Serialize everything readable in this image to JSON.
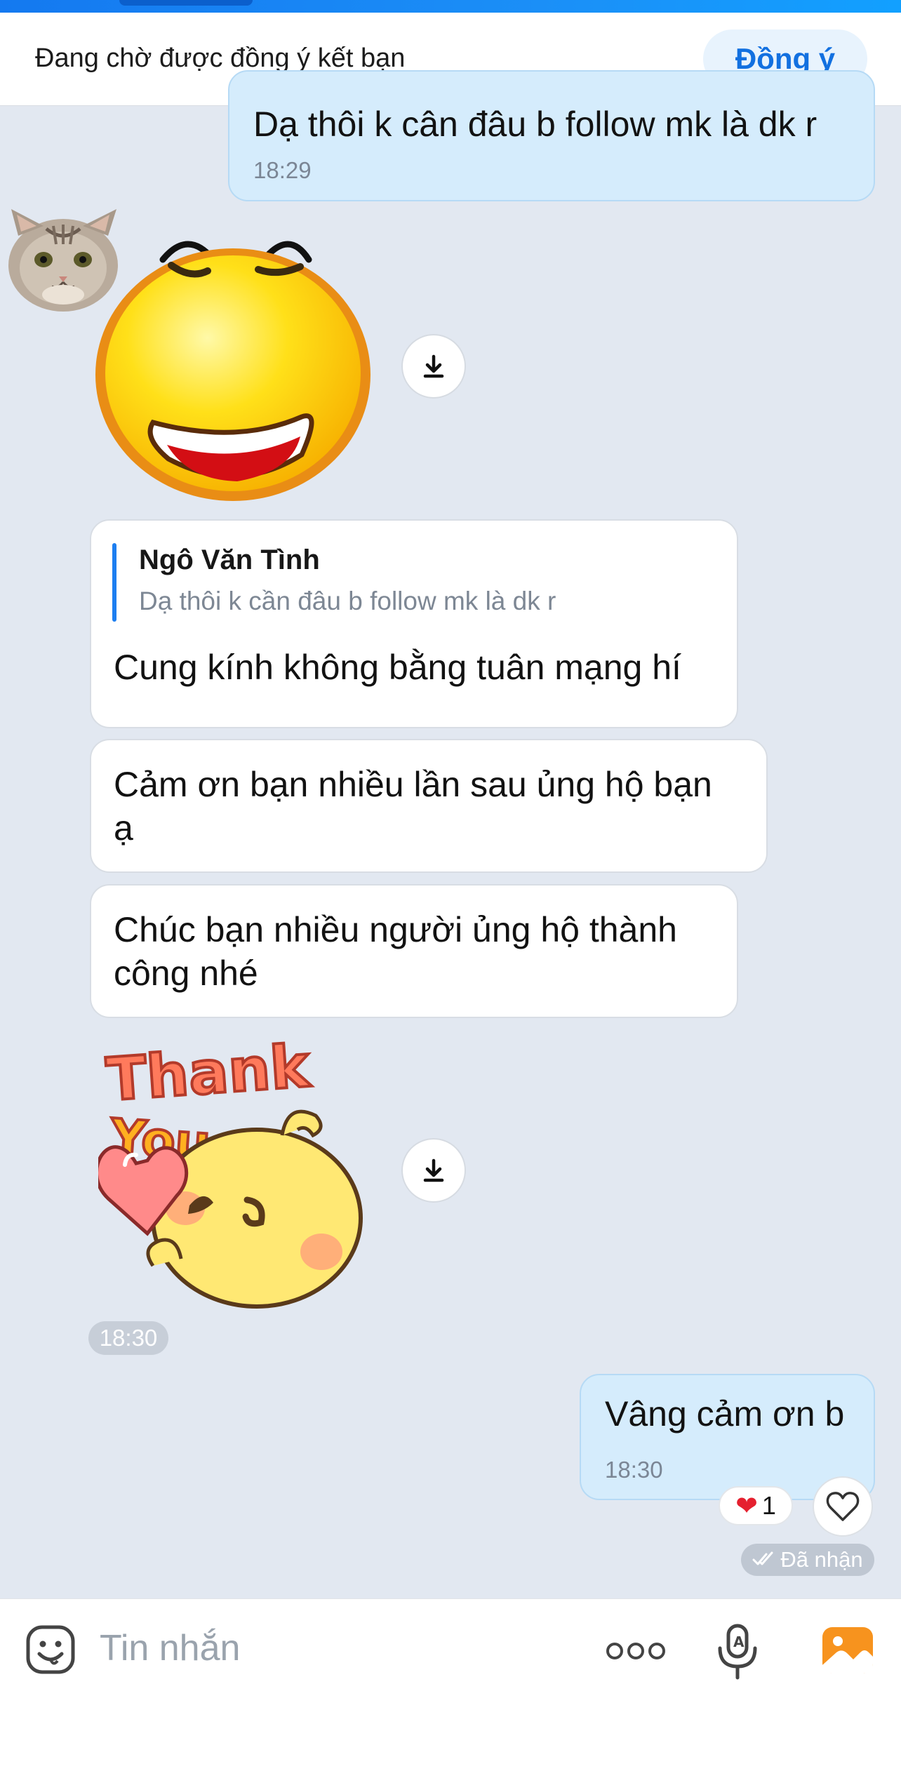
{
  "friend_request": {
    "text": "Đang chờ được đồng ý kết bạn",
    "accept_label": "Đồng ý"
  },
  "messages": {
    "out_1": {
      "text": "Dạ thôi k cân đâu b follow mk là dk r",
      "time": "18:29"
    },
    "reply": {
      "quoted_name": "Ngô Văn Tình",
      "quoted_text": "Dạ thôi k cần đâu b follow mk là dk r",
      "text": "Cung kính không bằng tuân mạng hí"
    },
    "in_2": {
      "text_line1": "Cảm ơn bạn nhiều lần sau ủng hộ bạn",
      "text_line2": "ạ"
    },
    "in_3": {
      "text_line1": "Chúc bạn nhiều người ủng hộ thành",
      "text_line2": "công nhé"
    },
    "sticker_2": {
      "line1": "Thank",
      "line2": "You"
    },
    "group_time": "18:30",
    "out_2": {
      "text": "Vâng cảm ơn b",
      "time": "18:30"
    }
  },
  "reaction": {
    "emoji": "❤",
    "count": "1"
  },
  "status": {
    "text": "Đã nhận"
  },
  "composer": {
    "placeholder": "Tin nhắn"
  },
  "icons": {
    "avatar": "cat-avatar",
    "download": "download-icon",
    "like": "heart-outline-icon",
    "emoji": "emoji-icon",
    "more": "more-dots-icon",
    "voice": "microphone-icon",
    "image": "image-icon"
  },
  "colors": {
    "accent": "#1270e0",
    "outgoing_bubble": "#d5ecfc",
    "background": "#e2e8f1",
    "image_icon": "#f7931e"
  }
}
